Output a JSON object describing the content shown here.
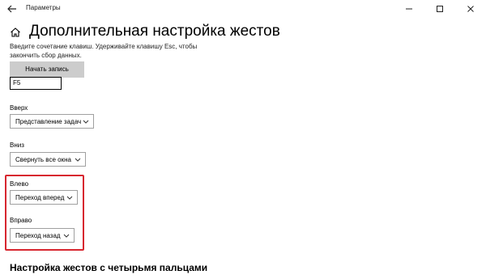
{
  "titlebar": {
    "title": "Параметры"
  },
  "page": {
    "title": "Дополнительная настройка жестов",
    "description": "Введите сочетание клавиш. Удерживайте клавишу Esc, чтобы закончить сбор данных.",
    "record_button": "Начать запись",
    "key_value": "F5"
  },
  "gestures": {
    "up": {
      "label": "Вверх",
      "value": "Представление задач"
    },
    "down": {
      "label": "Вниз",
      "value": "Свернуть все окна"
    },
    "left": {
      "label": "Влево",
      "value": "Переход вперед"
    },
    "right": {
      "label": "Вправо",
      "value": "Переход назад"
    }
  },
  "section": {
    "four_finger_title": "Настройка жестов с четырьмя пальцами"
  },
  "colors": {
    "highlight": "#d7262f",
    "button_bg": "#cccccc"
  },
  "icons": [
    "back-arrow-icon",
    "home-icon",
    "minimize-icon",
    "maximize-icon",
    "close-icon",
    "chevron-down-icon"
  ]
}
